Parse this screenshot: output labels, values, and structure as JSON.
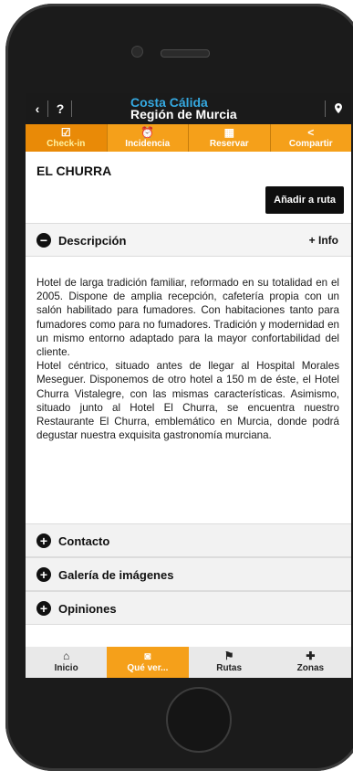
{
  "header": {
    "back_icon": "chevron-left-icon",
    "help_label": "?",
    "brand_line1": "Costa Cálida",
    "brand_line2": "Región de Murcia",
    "location_icon": "location-pin-icon"
  },
  "actions": [
    {
      "label": "Check-in",
      "icon": "checkbox-icon"
    },
    {
      "label": "Incidencia",
      "icon": "alarm-icon"
    },
    {
      "label": "Reservar",
      "icon": "calendar-icon"
    },
    {
      "label": "Compartir",
      "icon": "share-icon"
    }
  ],
  "page": {
    "title": "EL CHURRA",
    "add_route": "Añadir a ruta"
  },
  "description": {
    "label": "Descripción",
    "more": "+ Info",
    "para1": "Hotel de larga tradición familiar, reformado en su totalidad en el 2005. Dispone de amplia recepción, cafetería propia con un salón habilitado para fumadores. Con habitaciones tanto para fumadores como para no fumadores. Tradición y modernidad en un mismo entorno adaptado para la mayor confortabilidad del cliente.",
    "para2": "Hotel céntrico, situado antes de llegar al Hospital Morales Meseguer. Disponemos de otro hotel a 150 m de éste, el Hotel Churra Vistalegre, con las mismas características. Asimismo, situado junto al Hotel El Churra, se encuentra nuestro Restaurante El Churra, emblemático en Murcia, donde podrá degustar nuestra exquisita gastronomía murciana."
  },
  "sections": [
    {
      "label": "Contacto"
    },
    {
      "label": "Galería de imágenes"
    },
    {
      "label": "Opiniones"
    }
  ],
  "bottom_nav": [
    {
      "label": "Inicio",
      "icon": "home-icon"
    },
    {
      "label": "Qué ver...",
      "icon": "camera-icon"
    },
    {
      "label": "Rutas",
      "icon": "route-icon"
    },
    {
      "label": "Zonas",
      "icon": "zones-icon"
    }
  ],
  "colors": {
    "accent": "#f5a01a",
    "brand_blue": "#35a9e1",
    "header_bg": "#1a1a1a"
  }
}
